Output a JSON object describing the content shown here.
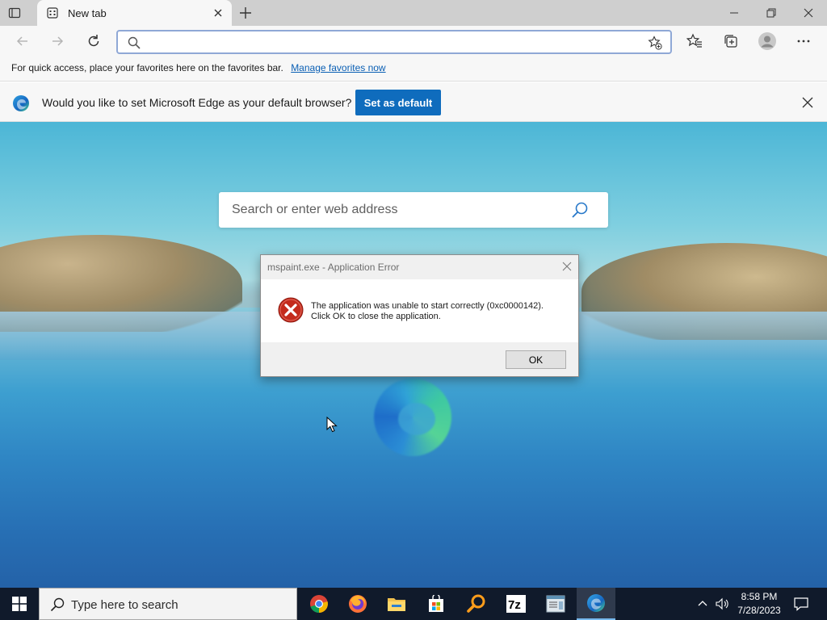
{
  "browser": {
    "tab_title": "New tab",
    "address_value": "",
    "favorites_bar": {
      "message": "For quick access, place your favorites here on the favorites bar.",
      "link": "Manage favorites now"
    },
    "infobar": {
      "message": "Would you like to set Microsoft Edge as your default browser?",
      "button": "Set as default"
    },
    "ntp_search_placeholder": "Search or enter web address"
  },
  "dialog": {
    "title": "mspaint.exe - Application Error",
    "line1": "The application was unable to start correctly (0xc0000142).",
    "line2": "Click OK to close the application.",
    "ok_label": "OK"
  },
  "taskbar": {
    "search_placeholder": "Type here to search",
    "apps": [
      "chrome-icon",
      "firefox-icon",
      "file-explorer-icon",
      "store-icon",
      "search-everything-icon",
      "7zip-icon",
      "notepad-icon",
      "edge-icon"
    ],
    "time": "8:58 PM",
    "date": "7/28/2023"
  },
  "colors": {
    "accent": "#0f6cbd",
    "taskbar": "#101a2b",
    "error_red": "#c42b1c"
  }
}
